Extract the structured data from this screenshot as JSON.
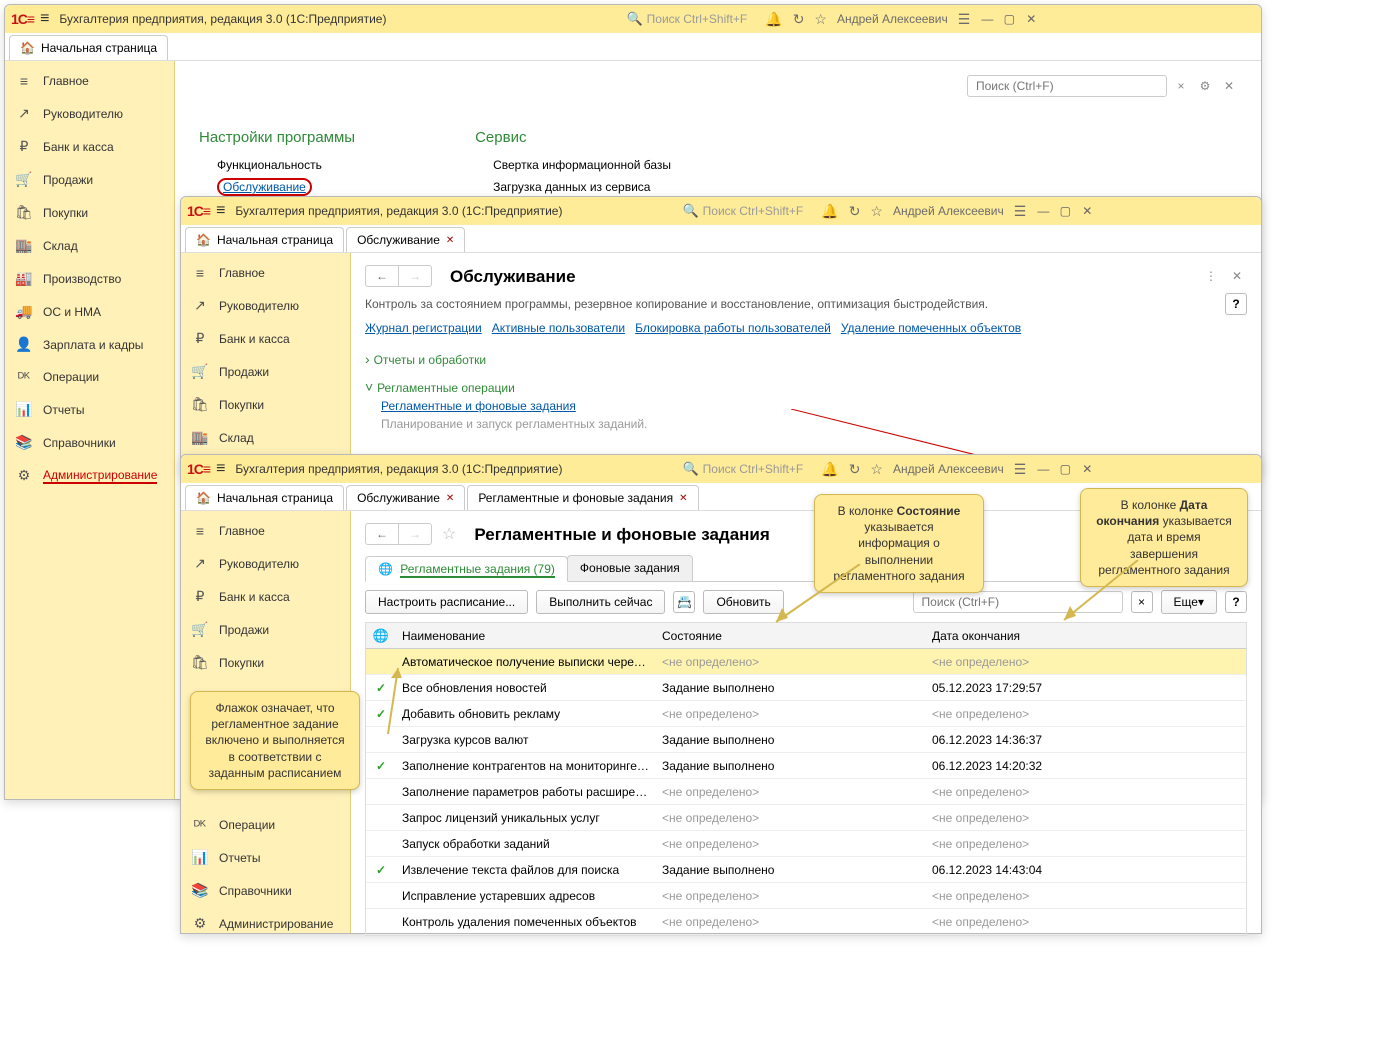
{
  "app": {
    "title": "Бухгалтерия предприятия, редакция 3.0  (1С:Предприятие)",
    "search_placeholder": "Поиск Ctrl+Shift+F",
    "username": "Андрей Алексеевич"
  },
  "sidebar": {
    "items": [
      {
        "icon": "≡",
        "label": "Главное"
      },
      {
        "icon": "↗",
        "label": "Руководителю"
      },
      {
        "icon": "₽",
        "label": "Банк и касса"
      },
      {
        "icon": "🛒",
        "label": "Продажи"
      },
      {
        "icon": "🛍",
        "label": "Покупки"
      },
      {
        "icon": "🏬",
        "label": "Склад"
      },
      {
        "icon": "🏭",
        "label": "Производство"
      },
      {
        "icon": "🚚",
        "label": "ОС и НМА"
      },
      {
        "icon": "👤",
        "label": "Зарплата и кадры"
      },
      {
        "icon": "ᴰᴷ",
        "label": "Операции"
      },
      {
        "icon": "📊",
        "label": "Отчеты"
      },
      {
        "icon": "📚",
        "label": "Справочники"
      },
      {
        "icon": "⚙",
        "label": "Администрирование"
      }
    ],
    "selected_index": 12,
    "short_items": [
      {
        "icon": "≡",
        "label": "Главное"
      },
      {
        "icon": "↗",
        "label": "Руководителю"
      },
      {
        "icon": "₽",
        "label": "Банк и касса"
      },
      {
        "icon": "🛒",
        "label": "Продажи"
      },
      {
        "icon": "🛍",
        "label": "Покупки"
      },
      {
        "icon": "🏬",
        "label": "Склад"
      }
    ],
    "mid_extra": [
      {
        "icon": "ᴰᴷ",
        "label": "Операции"
      },
      {
        "icon": "📊",
        "label": "Отчеты"
      },
      {
        "icon": "📚",
        "label": "Справочники"
      },
      {
        "icon": "⚙",
        "label": "Администрирование"
      }
    ]
  },
  "tabs": {
    "home": "Начальная страница",
    "maintenance": "Обслуживание",
    "tasks": "Регламентные и фоновые задания"
  },
  "win1": {
    "settings_head": "Настройки программы",
    "service_head": "Сервис",
    "functionality": "Функциональность",
    "maintenance": "Обслуживание",
    "svc1": "Свертка информационной базы",
    "svc2": "Загрузка данных из сервиса",
    "search_ph": "Поиск (Ctrl+F)"
  },
  "win2": {
    "page_title": "Обслуживание",
    "desc": "Контроль за состоянием программы, резервное копирование и восстановление, оптимизация быстродействия.",
    "links": [
      "Журнал регистрации",
      "Активные пользователи",
      "Блокировка работы пользователей",
      "Удаление помеченных объектов"
    ],
    "sec_reports": "Отчеты и обработки",
    "sec_ops": "Регламентные операции",
    "tasks_link": "Регламентные и фоновые задания",
    "tasks_desc": "Планирование и запуск регламентных заданий."
  },
  "win3": {
    "page_title": "Регламентные и фоновые задания",
    "tab1": "Регламентные задания (79)",
    "tab2": "Фоновые задания",
    "btn_schedule": "Настроить расписание...",
    "btn_run": "Выполнить сейчас",
    "btn_refresh": "Обновить",
    "btn_more": "Еще",
    "search_ph": "Поиск (Ctrl+F)",
    "columns": {
      "name": "Наименование",
      "state": "Состояние",
      "date": "Дата окончания"
    },
    "undefined": "<не определено>",
    "done": "Задание выполнено",
    "rows": [
      {
        "check": "",
        "name": "Автоматическое получение выписки через с…",
        "state": "undef",
        "date": "undef",
        "selected": true
      },
      {
        "check": "✓",
        "name": "Все обновления новостей",
        "state": "done",
        "date": "05.12.2023 17:29:57"
      },
      {
        "check": "✓",
        "name": "Добавить обновить рекламу",
        "state": "undef",
        "date": "undef"
      },
      {
        "check": "",
        "name": "Загрузка курсов валют",
        "state": "done",
        "date": "06.12.2023 14:36:37"
      },
      {
        "check": "✓",
        "name": "Заполнение контрагентов на мониторинге СП…",
        "state": "done",
        "date": "06.12.2023 14:20:32"
      },
      {
        "check": "",
        "name": "Заполнение параметров работы расширений",
        "state": "undef",
        "date": "undef"
      },
      {
        "check": "",
        "name": "Запрос лицензий уникальных услуг",
        "state": "undef",
        "date": "undef"
      },
      {
        "check": "",
        "name": "Запуск обработки заданий",
        "state": "undef",
        "date": "undef"
      },
      {
        "check": "✓",
        "name": "Извлечение текста файлов для поиска",
        "state": "done",
        "date": "06.12.2023 14:43:04"
      },
      {
        "check": "",
        "name": "Исправление устаревших адресов",
        "state": "undef",
        "date": "undef"
      },
      {
        "check": "",
        "name": "Контроль удаления помеченных объектов",
        "state": "undef",
        "date": "undef"
      }
    ]
  },
  "callouts": {
    "flag": "Флажок означает, что регламентное задание включено и выполняется в соответствии с заданным расписанием",
    "state_pre": "В колонке ",
    "state_bold": "Состояние",
    "state_post": " указывается информация о выполнении регламентного задания",
    "date_pre": "В колонке ",
    "date_bold": "Дата окончания",
    "date_post": " указывается дата и время завершения регламентного задания"
  }
}
